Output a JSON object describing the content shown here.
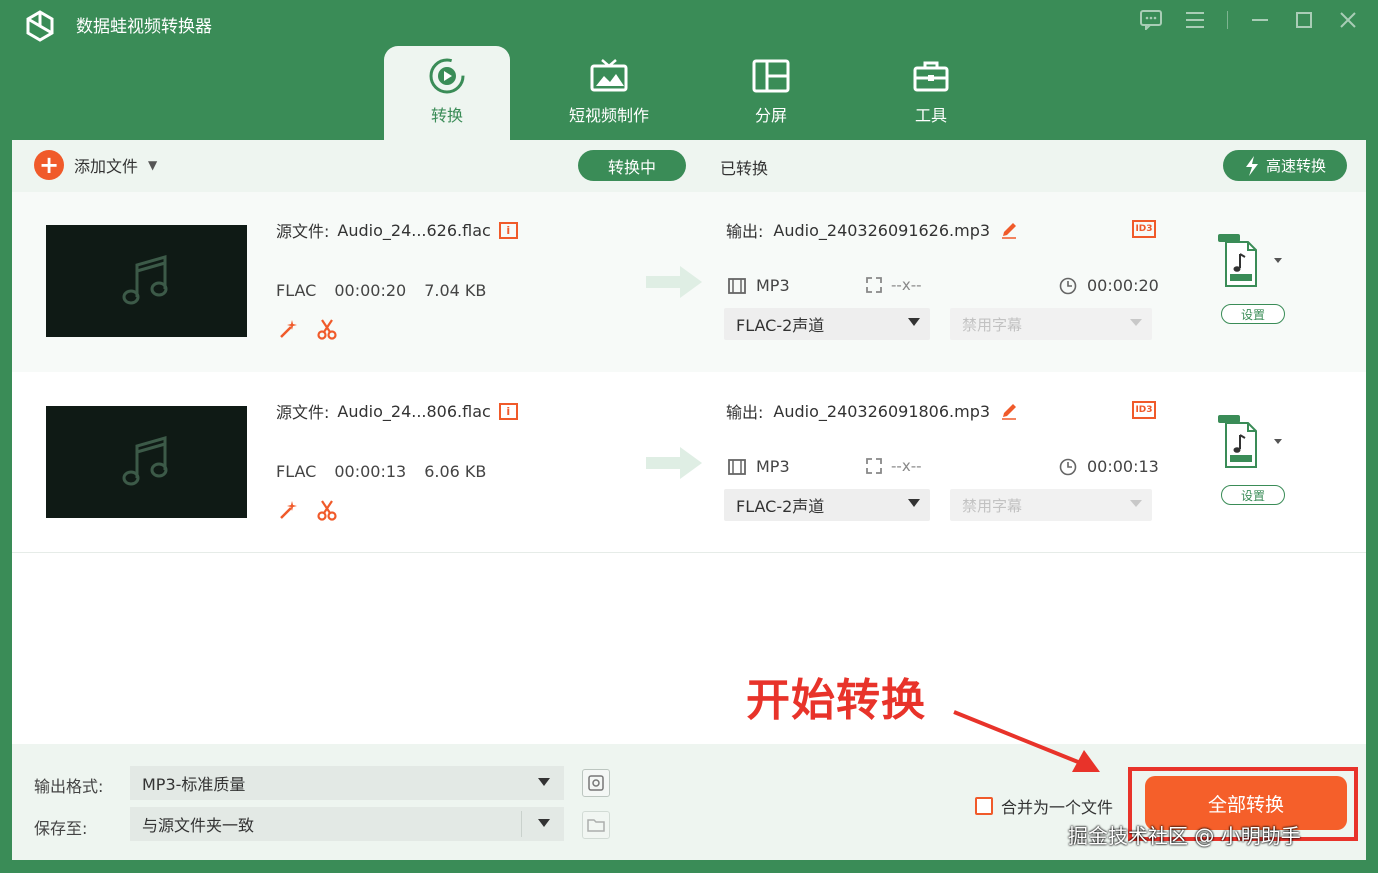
{
  "app": {
    "title": "数据蛙视频转换器"
  },
  "nav": {
    "tabs": [
      {
        "label": "转换",
        "icon": "convert-icon"
      },
      {
        "label": "短视频制作",
        "icon": "photo-icon"
      },
      {
        "label": "分屏",
        "icon": "split-screen-icon"
      },
      {
        "label": "工具",
        "icon": "toolbox-icon"
      }
    ]
  },
  "toolbar": {
    "add_label": "添加文件",
    "tab_converting": "转换中",
    "tab_converted": "已转换",
    "speed_label": "高速转换"
  },
  "files": [
    {
      "source_label": "源文件:",
      "source_name": "Audio_24...626.flac",
      "format": "FLAC",
      "duration": "00:00:20",
      "size": "7.04 KB",
      "output_label": "输出:",
      "output_name": "Audio_240326091626.mp3",
      "out_format": "MP3",
      "resolution": "--x--",
      "out_duration": "00:00:20",
      "audio_track": "FLAC-2声道",
      "subtitle": "禁用字幕",
      "settings_label": "设置",
      "id3_label": "ID3"
    },
    {
      "source_label": "源文件:",
      "source_name": "Audio_24...806.flac",
      "format": "FLAC",
      "duration": "00:00:13",
      "size": "6.06 KB",
      "output_label": "输出:",
      "output_name": "Audio_240326091806.mp3",
      "out_format": "MP3",
      "resolution": "--x--",
      "out_duration": "00:00:13",
      "audio_track": "FLAC-2声道",
      "subtitle": "禁用字幕",
      "settings_label": "设置",
      "id3_label": "ID3"
    }
  ],
  "bottom": {
    "format_label": "输出格式:",
    "format_value": "MP3-标准质量",
    "save_label": "保存至:",
    "save_value": "与源文件夹一致",
    "merge_label": "合并为一个文件",
    "convert_all_label": "全部转换"
  },
  "annotation": {
    "text": "开始转换",
    "watermark": "掘金技术社区 @ 小明助手"
  },
  "colors": {
    "brand_green": "#3a8c57",
    "accent_orange": "#f55f2a",
    "annotation_red": "#e8332a"
  }
}
